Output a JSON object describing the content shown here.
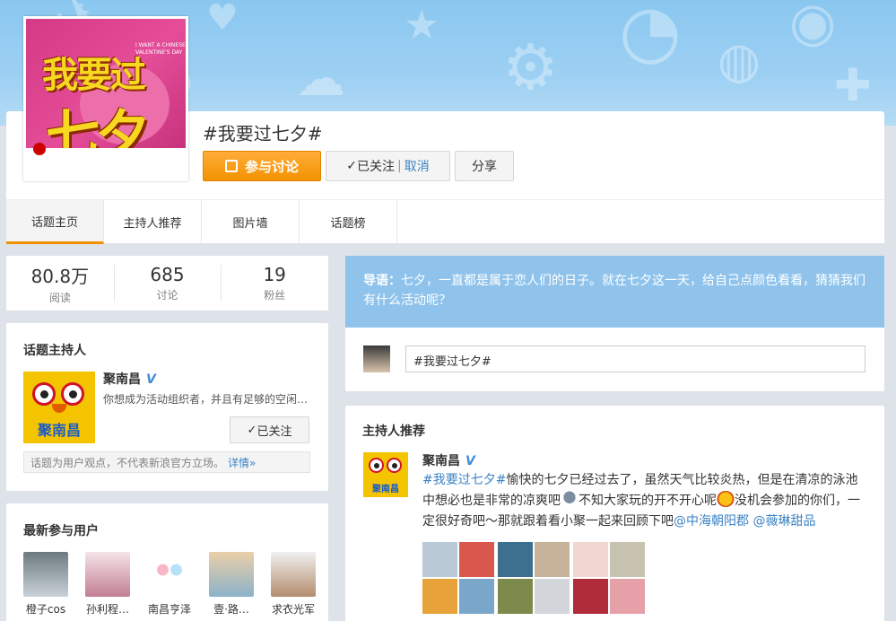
{
  "topic": {
    "cover_line1": "我要过",
    "cover_line2": "七夕",
    "cover_small": "I WANT A CHINESE VALENTINE'S DAY",
    "title": "#我要过七夕#",
    "join_label": "参与讨论",
    "follow_label": "已关注",
    "follow_sep": "|",
    "cancel_label": "取消",
    "share_label": "分享"
  },
  "tabs": [
    {
      "label": "话题主页",
      "active": true
    },
    {
      "label": "主持人推荐",
      "active": false
    },
    {
      "label": "图片墙",
      "active": false
    },
    {
      "label": "话题榜",
      "active": false
    }
  ],
  "stats": [
    {
      "value": "80.8万",
      "label": "阅读"
    },
    {
      "value": "685",
      "label": "讨论"
    },
    {
      "value": "19",
      "label": "粉丝"
    }
  ],
  "host": {
    "section_title": "话题主持人",
    "name": "聚南昌",
    "verified_badge": "V",
    "avatar_text": "聚南昌",
    "description": "你想成为活动组织者，并且有足够的空闲…",
    "followed_label": "已关注",
    "note": "话题为用户观点，不代表新浪官方立场。",
    "note_more": "详情»"
  },
  "users": {
    "section_title": "最新参与用户",
    "items": [
      {
        "name": "橙子cos"
      },
      {
        "name": "孙利程…"
      },
      {
        "name": "南昌亨泽"
      },
      {
        "name": "壹·路…"
      },
      {
        "name": "求衣光军"
      }
    ]
  },
  "intro": {
    "lead": "导语：",
    "text": "七夕，一直都是属于恋人们的日子。就在七夕这一天，给自己点颜色看看，猜猜我们有什么活动呢？"
  },
  "composer": {
    "value": "#我要过七夕#"
  },
  "recommend": {
    "section_title": "主持人推荐",
    "name": "聚南昌",
    "verified_badge": "V",
    "avatar_text": "聚南昌",
    "tag": "#我要过七夕#",
    "text1": "愉快的七夕已经过去了，虽然天气比较炎热，但是在清凉的泳池中想必也是非常的凉爽吧",
    "text2": "不知大家玩的开不开心呢",
    "text3": "没机会参加的你们，一定很好奇吧～那就跟着看小聚一起来回顾下吧",
    "mention1": "@中海朝阳郡",
    "mention2": "@薇琳甜品"
  },
  "colors": {
    "accent_orange": "#f39200",
    "link_blue": "#3a82c4",
    "intro_blue": "#8fc3eb",
    "banner_blue": "#9dd0f3"
  }
}
